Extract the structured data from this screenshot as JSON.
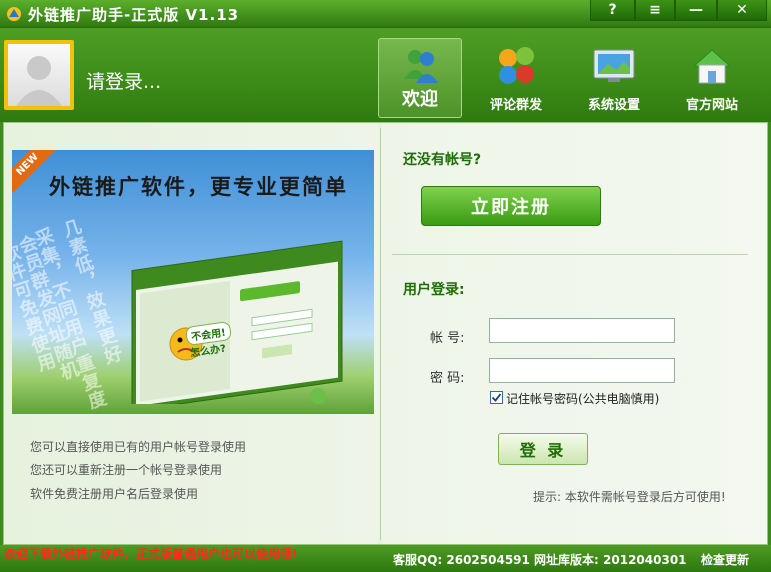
{
  "window": {
    "title": "外链推广助手-正式版 V1.13",
    "help_label": "?",
    "menu_label": "≡",
    "minimize_label": "—",
    "close_label": "✕"
  },
  "header": {
    "login_prompt": "请登录...",
    "nav": [
      {
        "label": "欢迎",
        "icon": "msn-people-icon"
      },
      {
        "label": "评论群发",
        "icon": "colored-dots-icon"
      },
      {
        "label": "系统设置",
        "icon": "monitor-icon"
      },
      {
        "label": "官方网站",
        "icon": "home-icon"
      }
    ]
  },
  "banner": {
    "ribbon": "NEW",
    "title": "外链推广软件，更专业更简单",
    "side_texts": [
      "几素低，效果更好",
      "采集，不同用户重复度",
      "会员群发网址随机",
      "软件可免费使用"
    ],
    "mini_badge_line1": "不会用!",
    "mini_badge_line2": "怎么办?"
  },
  "left_info": [
    "您可以直接使用已有的用户帐号登录使用",
    "您还可以重新注册一个帐号登录使用",
    "软件免费注册用户名后登录使用"
  ],
  "login": {
    "no_account": "还没有帐号?",
    "register_label": "立即注册",
    "user_login": "用户登录:",
    "account_label": "帐    号:",
    "password_label": "密    码:",
    "account_value": "",
    "password_value": "",
    "remember_label": "记住帐号密码(公共电脑慎用)",
    "remember_checked": true,
    "login_label": "登 录",
    "hint": "提示: 本软件需帐号登录后方可使用!"
  },
  "status": {
    "left": "欢迎下载外链推广软件，正式版普通用户也可以使用哦!",
    "right": "客服QQ: 2602504591 网址库版本: 2012040301",
    "check_update": "检查更新"
  },
  "colors": {
    "primary_green": "#3f8a1f",
    "accent_yellow": "#f0c20c",
    "status_red": "#ff2a1a"
  }
}
